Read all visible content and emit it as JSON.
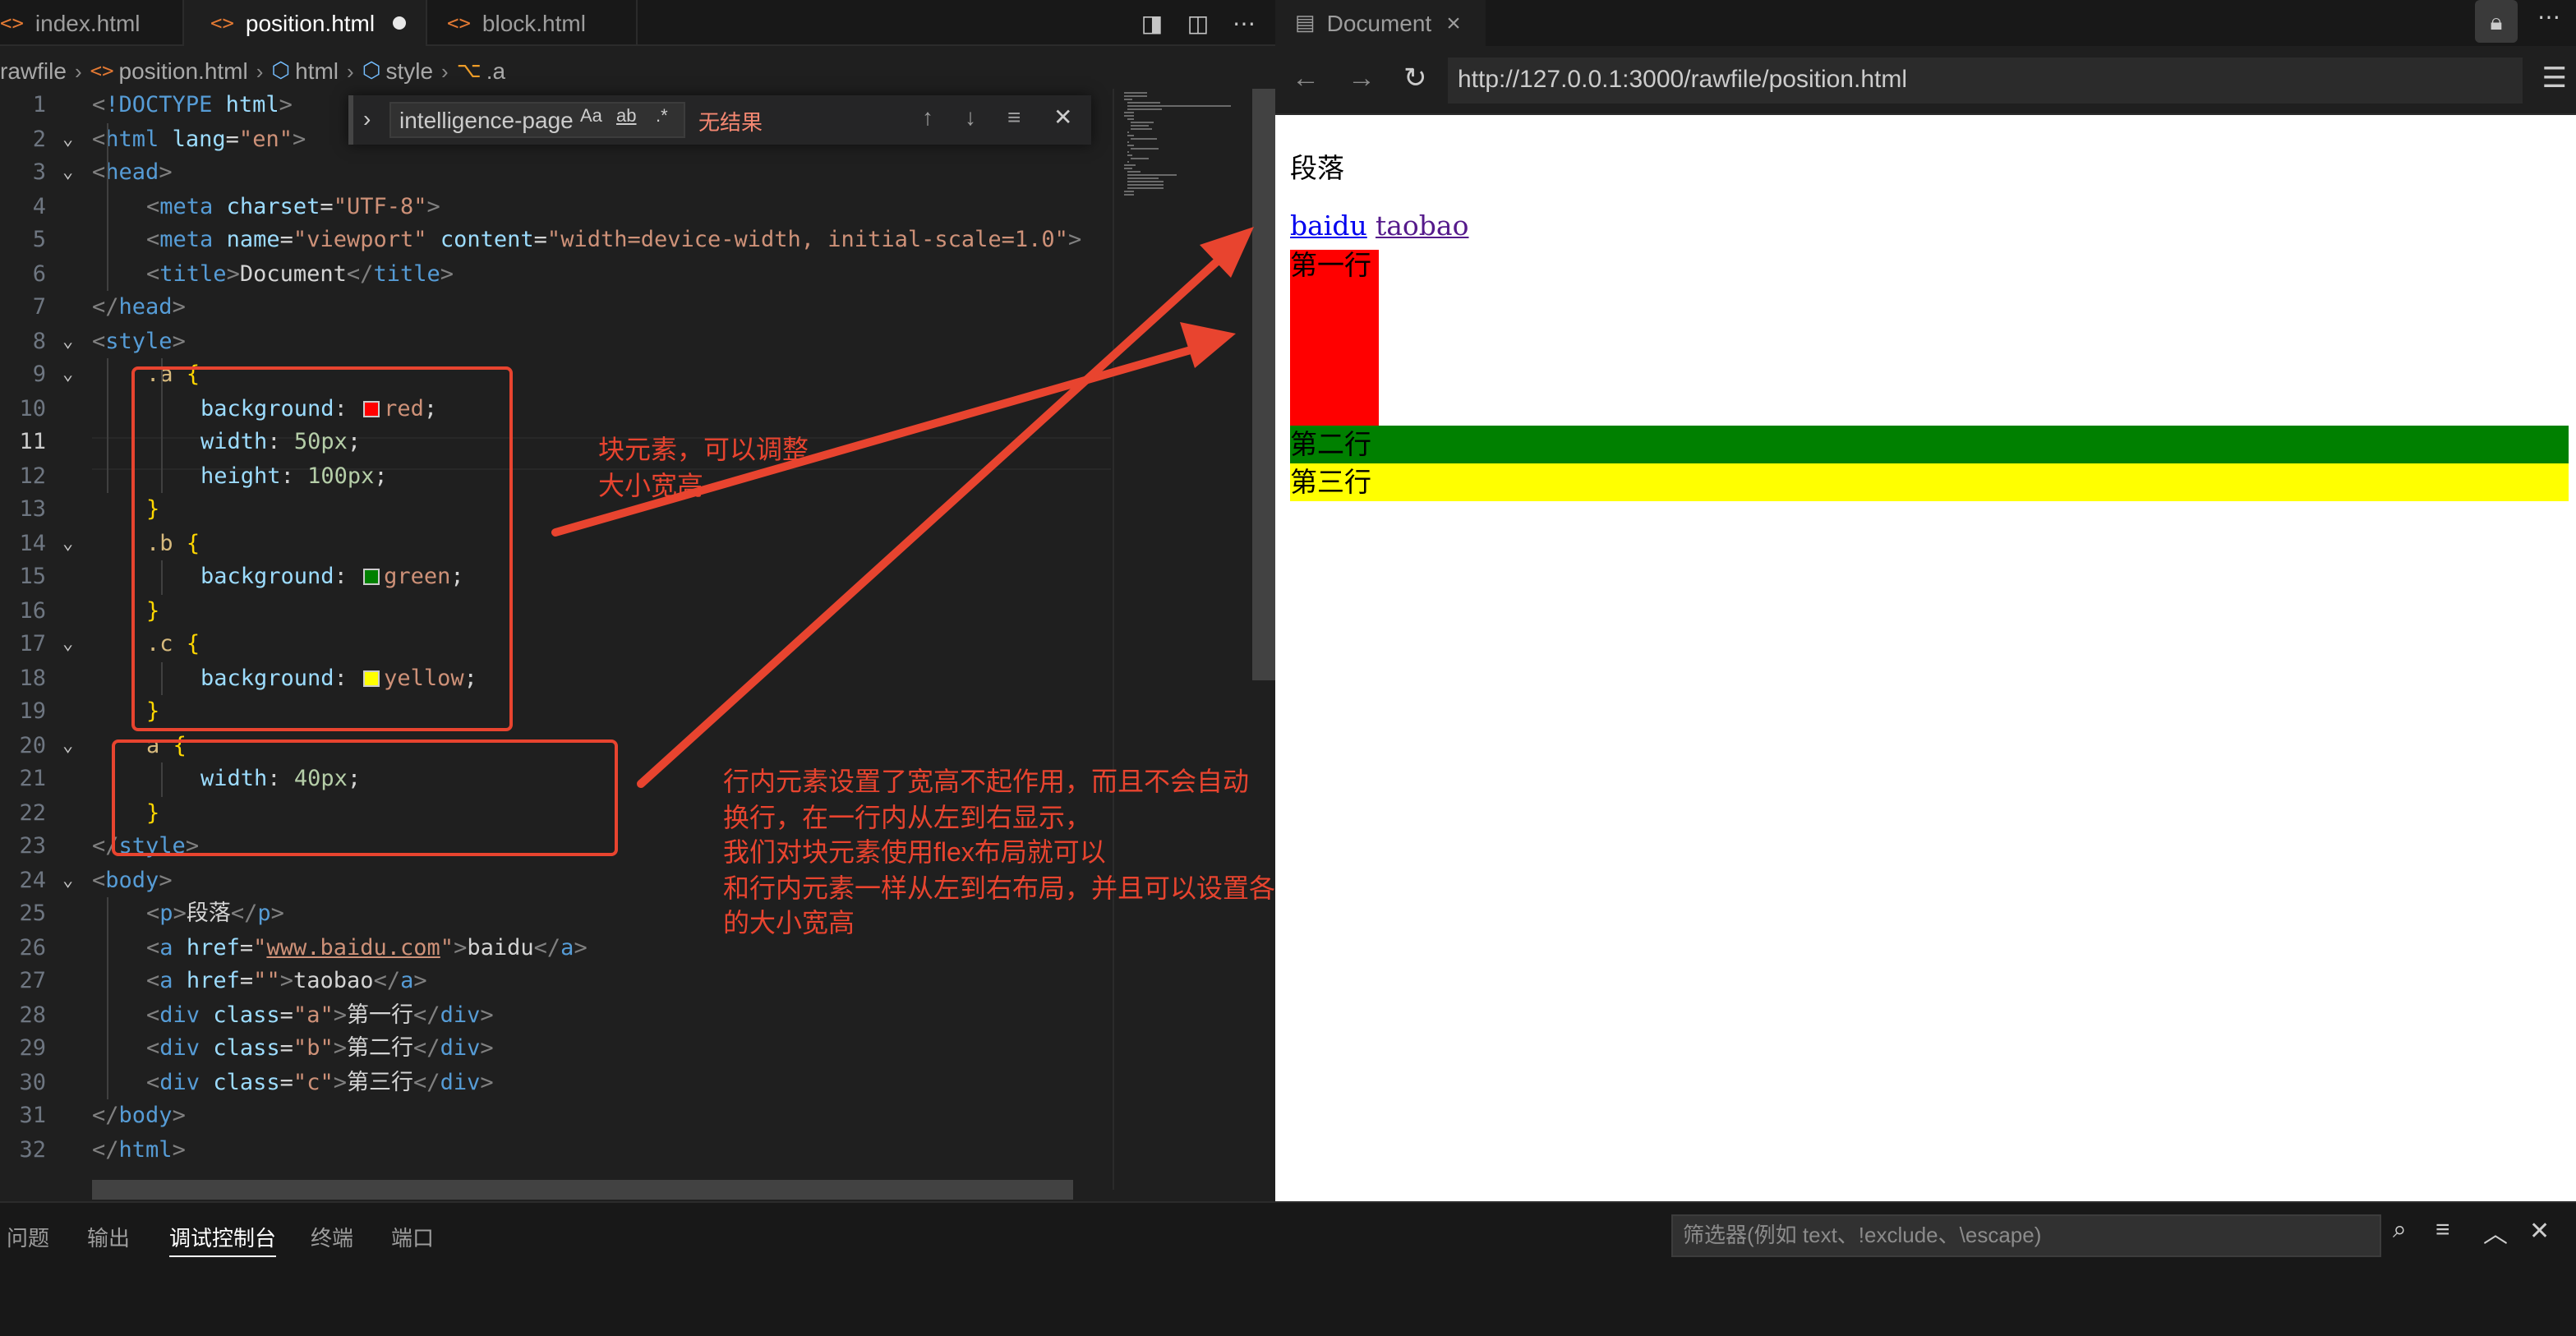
{
  "editor": {
    "tabs": [
      {
        "label": "index.html",
        "icon": "<>"
      },
      {
        "label": "position.html",
        "icon": "<>",
        "unsaved": true
      },
      {
        "label": "block.html",
        "icon": "<>"
      }
    ],
    "breadcrumb": [
      "rawfile",
      "position.html",
      "html",
      "style",
      ".a"
    ],
    "find": {
      "query": "intelligence-page",
      "case_label": "Aa",
      "word_label": "ab",
      "regex_label": ".*",
      "result": "无结果"
    },
    "current_line": 11
  },
  "code_lines": [
    "<!DOCTYPE html>",
    "<html lang=\"en\">",
    "<head>",
    "<meta charset=\"UTF-8\">",
    "<meta name=\"viewport\" content=\"width=device-width, initial-scale=1.0\">",
    "<title>Document</title>",
    "</head>",
    "<style>",
    ".a {",
    "background: red;",
    "width: 50px;",
    "height: 100px;",
    "}",
    ".b {",
    "background: green;",
    "}",
    ".c {",
    "background: yellow;",
    "}",
    "a {",
    "width: 40px;",
    "}",
    "</style>",
    "<body>",
    "<p>段落</p>",
    "<a href=\"www.baidu.com\">baidu</a>",
    "<a href=\"\">taobao</a>",
    "<div class=\"a\">第一行</div>",
    "<div class=\"b\">第二行</div>",
    "<div class=\"c\">第三行</div>",
    "</body>",
    "</html>"
  ],
  "annotations": {
    "note1": [
      "块元素，可以调整",
      "大小宽高"
    ],
    "note2": [
      "行内元素设置了宽高不起作用，而且不会自动",
      "换行，在一行内从左到右显示，",
      "我们对块元素使用flex布局就可以",
      "和行内元素一样从左到右布局，并且可以设置各自",
      "的大小宽高"
    ]
  },
  "browser": {
    "tab_title": "Document",
    "url": "http://127.0.0.1:3000/rawfile/position.html",
    "content": {
      "paragraph": "段落",
      "link1": "baidu",
      "link2": "taobao",
      "div_a": "第一行",
      "div_b": "第二行",
      "div_c": "第三行"
    }
  },
  "panel": {
    "tabs": [
      "问题",
      "输出",
      "调试控制台",
      "终端",
      "端口"
    ],
    "active_tab": "调试控制台",
    "filter_placeholder": "筛选器(例如 text、!exclude、\\escape)"
  },
  "colors": {
    "annotation": "#e8442f",
    "div_a_bg": "#ff0000",
    "div_b_bg": "#008000",
    "div_c_bg": "#ffff00"
  }
}
